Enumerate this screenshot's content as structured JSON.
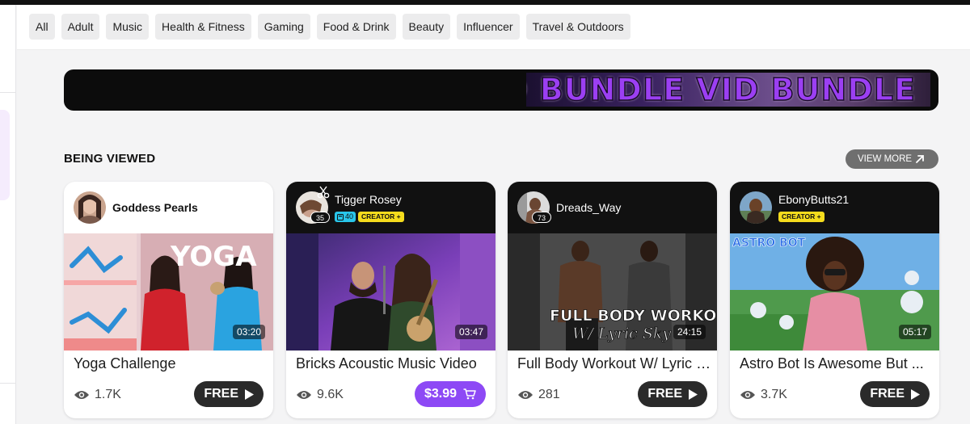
{
  "categories": [
    "All",
    "Adult",
    "Music",
    "Health & Fitness",
    "Gaming",
    "Food & Drink",
    "Beauty",
    "Influencer",
    "Travel & Outdoors"
  ],
  "banner": {
    "text": "D BUNDLE VID BUNDLE"
  },
  "section": {
    "title": "BEING VIEWED",
    "view_more_label": "VIEW MORE"
  },
  "cards": [
    {
      "creator": "Goddess Pearls",
      "duration": "03:20",
      "title": "Yoga Challenge",
      "views": "1.7K",
      "price": "FREE",
      "thumb_text": "YOGA"
    },
    {
      "creator": "Tigger Rosey",
      "avatar_count": "35",
      "tag_count": "40",
      "tag_label": "CREATOR +",
      "duration": "03:47",
      "title": "Bricks Acoustic Music Video",
      "views": "9.6K",
      "price": "$3.99"
    },
    {
      "creator": "Dreads_Way",
      "avatar_count": "73",
      "duration": "24:15",
      "title": "Full Body Workout W/ Lyric Sky",
      "views": "281",
      "price": "FREE",
      "thumb_text": "FULL BODY WORKOUT",
      "thumb_text2": "W/ Lyric Sky"
    },
    {
      "creator": "EbonyButts21",
      "tag_label": "CREATOR +",
      "duration": "05:17",
      "title": "Astro Bot Is Awesome But ...",
      "views": "3.7K",
      "price": "FREE",
      "thumb_text": "ASTRO BOT"
    }
  ]
}
